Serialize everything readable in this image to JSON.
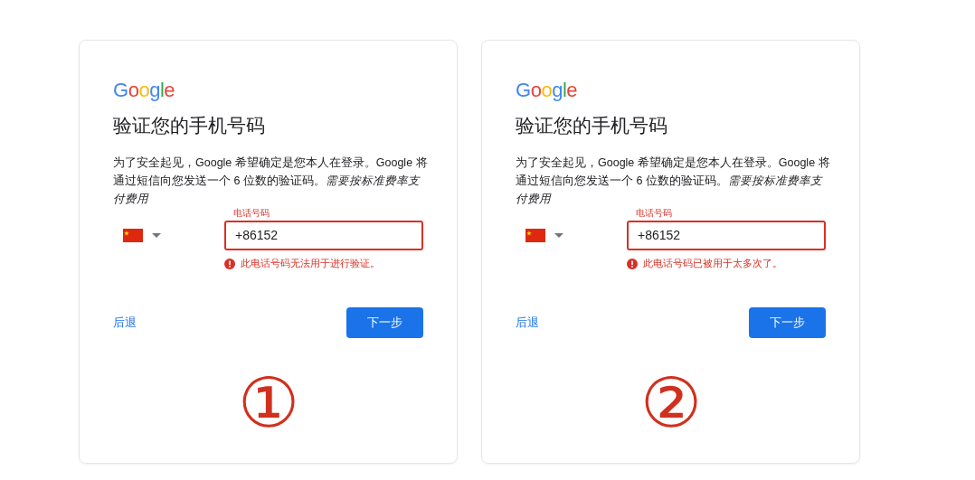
{
  "cards": [
    {
      "logo": "Google",
      "title": "验证您的手机号码",
      "description": "为了安全起见，Google 希望确定是您本人在登录。Google 将通过短信向您发送一个 6 位数的验证码。*需要按标准费率支付费用*",
      "phone_field": {
        "label": "电话号码",
        "value": "+86152",
        "error": true
      },
      "error_message": "此电话号码无法用于进行验证。",
      "back_link": "后退",
      "next_button": "下一步",
      "marker": "①"
    },
    {
      "logo": "Google",
      "title": "验证您的手机号码",
      "description": "为了安全起见，Google 希望确定是您本人在登录。Google 将通过短信向您发送一个 6 位数的验证码。*需要按标准费率支付费用*",
      "phone_field": {
        "label": "电话号码",
        "value": "+86152",
        "error": true
      },
      "error_message": "此电话号码已被用于太多次了。",
      "back_link": "后退",
      "next_button": "下一步",
      "marker": "②"
    }
  ]
}
